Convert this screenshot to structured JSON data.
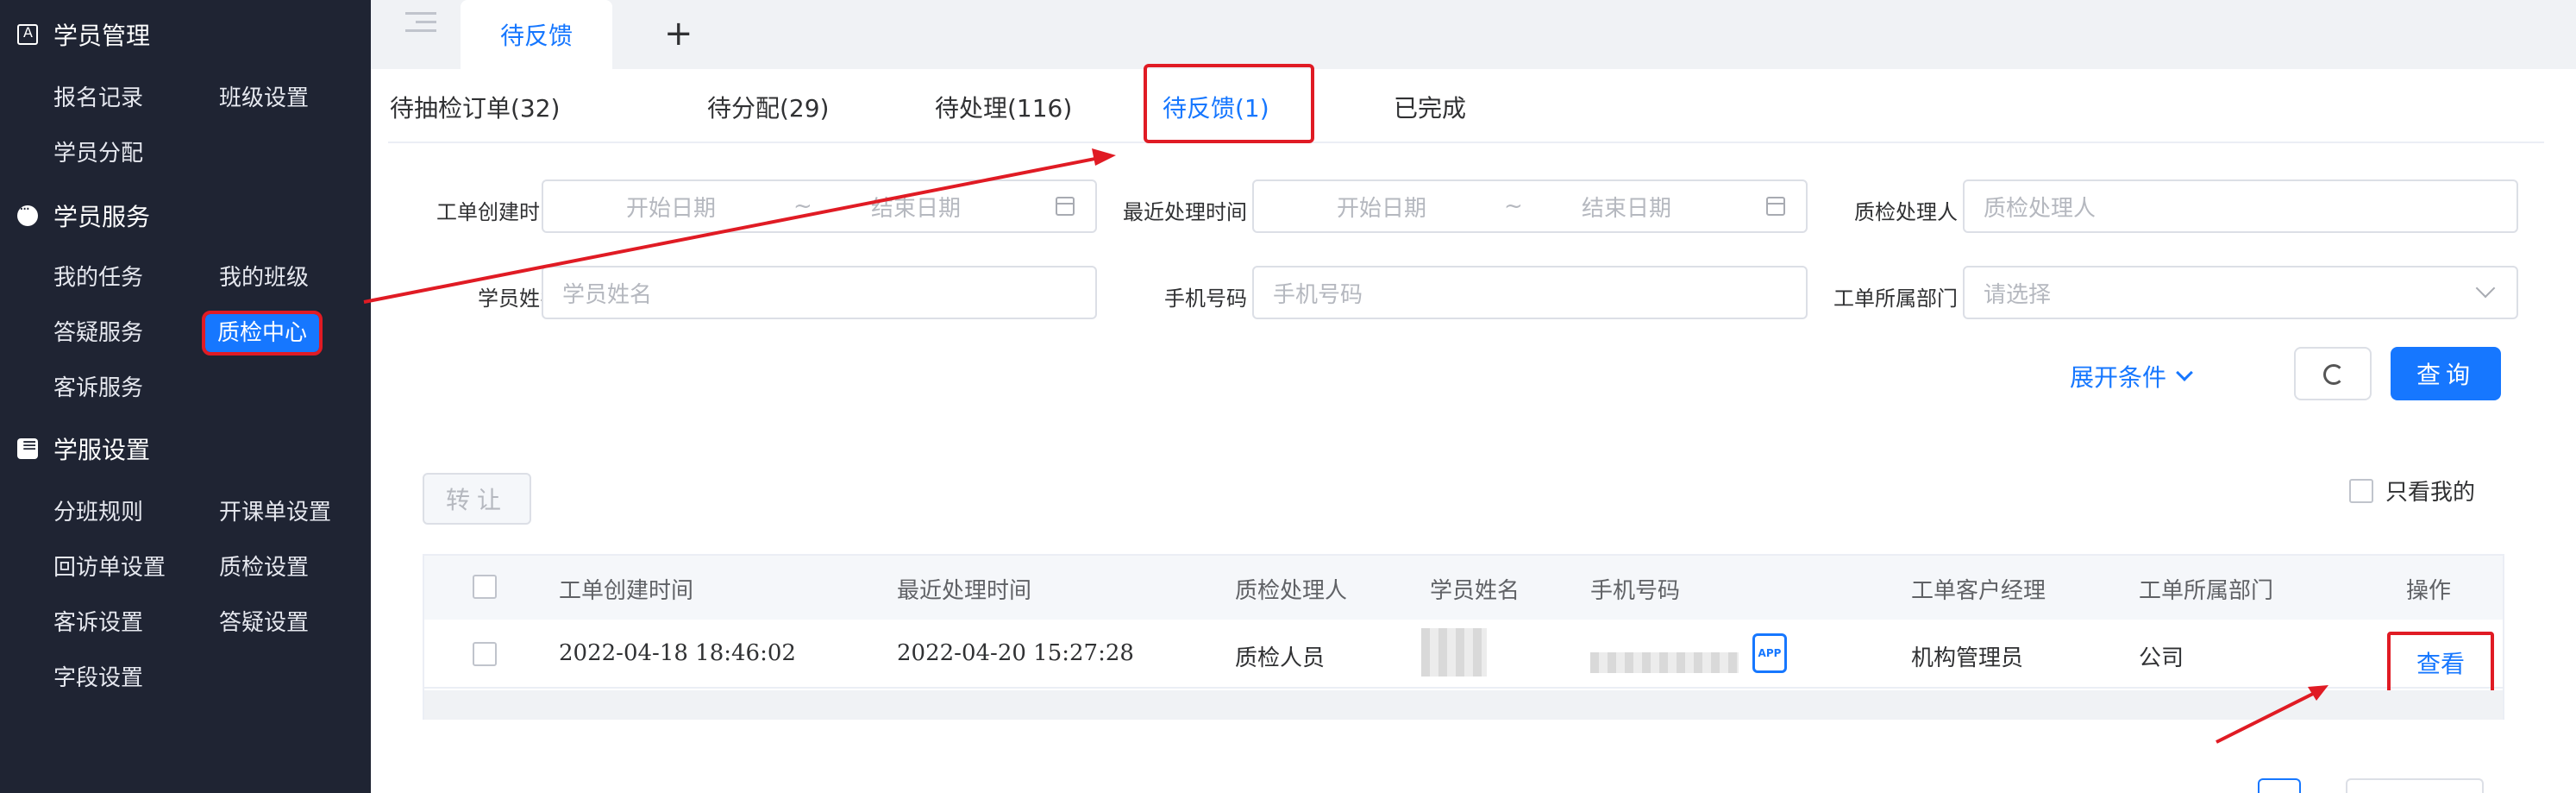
{
  "sidebar": {
    "groups": [
      {
        "title": "学员管理",
        "icon": "book-icon",
        "items": [
          "报名记录",
          "班级设置",
          "学员分配"
        ]
      },
      {
        "title": "学员服务",
        "icon": "chat-icon",
        "items": [
          "我的任务",
          "我的班级",
          "答疑服务",
          "质检中心",
          "客诉服务"
        ]
      },
      {
        "title": "学服设置",
        "icon": "settings-icon",
        "items": [
          "分班规则",
          "开课单设置",
          "回访单设置",
          "质检设置",
          "客诉设置",
          "答疑设置",
          "字段设置"
        ]
      }
    ],
    "active_item": "质检中心"
  },
  "topbar": {
    "page_tab": "待反馈",
    "add_tab_label": "+"
  },
  "subtabs": [
    "待抽检订单(32)",
    "待分配(29)",
    "待处理(116)",
    "待反馈(1)",
    "已完成"
  ],
  "active_subtab": "待反馈(1)",
  "filters": {
    "create_time_label": "工单创建时间",
    "last_process_label": "最近处理时间",
    "inspector_label": "质检处理人",
    "student_label": "学员姓名",
    "phone_label": "手机号码",
    "dept_label": "工单所属部门",
    "start_date_ph": "开始日期",
    "end_date_ph": "结束日期",
    "range_sep": "~",
    "inspector_ph": "质检处理人",
    "student_ph": "学员姓名",
    "phone_ph": "手机号码",
    "dept_ph": "请选择",
    "expand_label": "展开条件",
    "query_label": "查询"
  },
  "actions": {
    "transfer_label": "转让",
    "only_mine_label": "只看我的"
  },
  "table": {
    "columns": [
      "工单创建时间",
      "最近处理时间",
      "质检处理人",
      "学员姓名",
      "手机号码",
      "工单客户经理",
      "工单所属部门",
      "操作"
    ],
    "rows": [
      {
        "create_time": "2022-04-18 18:46:02",
        "last_process": "2022-04-20 15:27:28",
        "inspector": "质检人员",
        "manager": "机构管理员",
        "dept": "公司",
        "app_badge": "APP",
        "action": "查看"
      }
    ]
  },
  "colors": {
    "primary": "#1677ff",
    "sidebar_bg": "#1f2433",
    "highlight": "#e01b24"
  }
}
